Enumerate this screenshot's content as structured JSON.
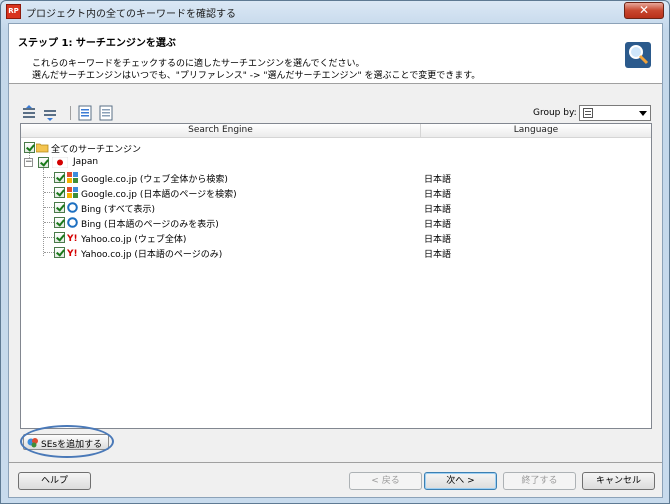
{
  "window": {
    "app_icon_text": "RP",
    "title": "プロジェクト内の全てのキーワードを確認する",
    "close_glyph": "✕"
  },
  "header": {
    "step_title": "ステップ 1: サーチエンジンを選ぶ",
    "description_line1": "これらのキーワードをチェックするのに適したサーチエンジンを選んでください。",
    "description_line2": "選んだサーチエンジンはいつでも、\"プリファレンス\" -> \"選んだサーチエンジン\" を選ぶことで変更できます。",
    "icon": "magnifier-icon"
  },
  "toolbar": {
    "group_by_label": "Group by:",
    "group_by_value": "",
    "icons": [
      "expand-all-icon",
      "collapse-all-icon",
      "check-all-icon",
      "uncheck-all-icon"
    ]
  },
  "grid": {
    "columns": [
      "Search Engine",
      "Language"
    ],
    "root": {
      "label": "全てのサーチエンジン",
      "checked": true
    },
    "country": {
      "label": "Japan",
      "checked": true,
      "flag": "japan-flag-icon"
    },
    "engines": [
      {
        "label": "Google.co.jp (ウェブ全体から検索)",
        "language": "日本語",
        "icon": "google-icon",
        "checked": true
      },
      {
        "label": "Google.co.jp (日本語のページを検索)",
        "language": "日本語",
        "icon": "google-icon",
        "checked": true
      },
      {
        "label": "Bing (すべて表示)",
        "language": "日本語",
        "icon": "bing-icon",
        "checked": true
      },
      {
        "label": "Bing (日本語のページのみを表示)",
        "language": "日本語",
        "icon": "bing-icon",
        "checked": true
      },
      {
        "label": "Yahoo.co.jp (ウェブ全体)",
        "language": "日本語",
        "icon": "yahoo-icon",
        "checked": true
      },
      {
        "label": "Yahoo.co.jp (日本語のページのみ)",
        "language": "日本語",
        "icon": "yahoo-icon",
        "checked": true
      }
    ]
  },
  "add_se_button": {
    "label": "SEsを追加する",
    "icon": "add-search-engine-icon"
  },
  "footer": {
    "help": "ヘルプ",
    "back": "< 戻る",
    "next": "次へ >",
    "finish": "終了する",
    "cancel": "キャンセル"
  },
  "colors": {
    "accent": "#4a79b8",
    "google": "#3f8e3a",
    "bing": "#1c6fc0",
    "yahoo": "#d40000"
  }
}
